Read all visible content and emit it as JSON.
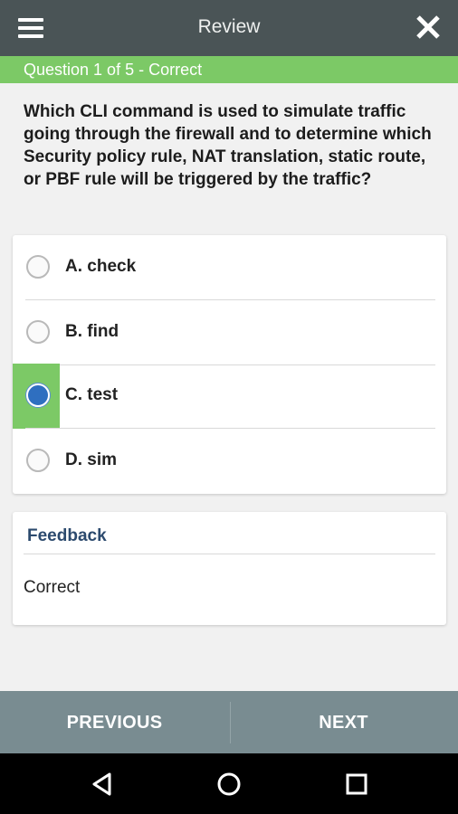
{
  "header": {
    "title": "Review",
    "menu_icon": "hamburger-icon",
    "close_icon": "close-icon"
  },
  "status": {
    "text": "Question 1 of 5 - Correct",
    "color": "#7cc966"
  },
  "question": {
    "text": "Which CLI command is used to simulate traffic going through the firewall and to determine which Security policy rule, NAT translation, static route, or PBF rule will be triggered by the traffic?"
  },
  "options": [
    {
      "label": "A. check",
      "selected": false,
      "correct": false
    },
    {
      "label": "B. find",
      "selected": false,
      "correct": false
    },
    {
      "label": "C. test",
      "selected": true,
      "correct": true
    },
    {
      "label": "D. sim",
      "selected": false,
      "correct": false
    }
  ],
  "feedback": {
    "heading": "Feedback",
    "text": "Correct"
  },
  "footer": {
    "previous_label": "PREVIOUS",
    "next_label": "NEXT"
  },
  "system_nav": {
    "back_icon": "back-triangle-icon",
    "home_icon": "home-circle-icon",
    "recents_icon": "recents-square-icon"
  },
  "colors": {
    "header_bg": "#4a5456",
    "accent_green": "#7cc966",
    "radio_selected": "#2f6fc0",
    "footer_bg": "#798c91"
  }
}
